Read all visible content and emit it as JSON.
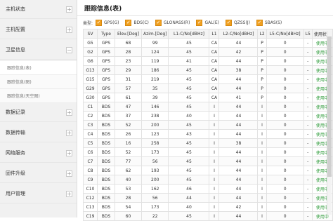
{
  "sidebar": {
    "sections": [
      {
        "label": "主机状态"
      },
      {
        "label": "主机配置"
      },
      {
        "label": "卫星信息",
        "sub": [
          {
            "label": "跟踪信息(表)"
          },
          {
            "label": "跟踪信息(图)"
          },
          {
            "label": "跟踪信息(天空图)"
          }
        ]
      },
      {
        "label": "数据记录"
      },
      {
        "label": "数据传输"
      },
      {
        "label": "网络服务"
      },
      {
        "label": "固件升级"
      },
      {
        "label": "用户管理"
      }
    ]
  },
  "page": {
    "title": "跟踪信息(表)"
  },
  "filters": {
    "label": "类型:",
    "items": [
      {
        "label": "GPS(G)",
        "checked": true
      },
      {
        "label": "BDS(C)",
        "checked": true
      },
      {
        "label": "GLONASS(R)",
        "checked": true
      },
      {
        "label": "GAL(E)",
        "checked": true
      },
      {
        "label": "QZSS(J)",
        "checked": true
      },
      {
        "label": "SBAS(S)",
        "checked": true
      }
    ]
  },
  "table": {
    "columns": [
      "SV",
      "Type",
      "Elev.[Deg]",
      "Azim.[Deg]",
      "L1-C/No[dBHz]",
      "L1",
      "L2-C/No[dBHz]",
      "L2",
      "L5-C/No[dBHz]",
      "L5",
      "使用状态"
    ],
    "rows": [
      [
        "G5",
        "GPS",
        "68",
        "99",
        "45",
        "CA",
        "44",
        "P",
        "0",
        "-",
        "使用中"
      ],
      [
        "G2",
        "GPS",
        "28",
        "124",
        "45",
        "CA",
        "42",
        "P",
        "0",
        "-",
        "使用中"
      ],
      [
        "G6",
        "GPS",
        "23",
        "119",
        "41",
        "CA",
        "44",
        "P",
        "0",
        "-",
        "使用中"
      ],
      [
        "G13",
        "GPS",
        "29",
        "186",
        "45",
        "CA",
        "38",
        "P",
        "0",
        "-",
        "使用中"
      ],
      [
        "G15",
        "GPS",
        "31",
        "219",
        "45",
        "CA",
        "44",
        "P",
        "0",
        "-",
        "使用中"
      ],
      [
        "G29",
        "GPS",
        "57",
        "35",
        "45",
        "CA",
        "44",
        "P",
        "0",
        "-",
        "使用中"
      ],
      [
        "G30",
        "GPS",
        "61",
        "39",
        "45",
        "CA",
        "41",
        "P",
        "0",
        "-",
        "使用中"
      ],
      [
        "C1",
        "BDS",
        "47",
        "146",
        "45",
        "I",
        "44",
        "I",
        "0",
        "-",
        "使用中"
      ],
      [
        "C2",
        "BDS",
        "37",
        "238",
        "40",
        "I",
        "44",
        "I",
        "0",
        "-",
        "使用中"
      ],
      [
        "C3",
        "BDS",
        "52",
        "200",
        "45",
        "I",
        "44",
        "I",
        "0",
        "-",
        "使用中"
      ],
      [
        "C4",
        "BDS",
        "26",
        "123",
        "43",
        "I",
        "44",
        "I",
        "0",
        "-",
        "使用中"
      ],
      [
        "C5",
        "BDS",
        "16",
        "258",
        "45",
        "I",
        "38",
        "I",
        "0",
        "-",
        "使用中"
      ],
      [
        "C6",
        "BDS",
        "52",
        "173",
        "45",
        "I",
        "44",
        "I",
        "0",
        "-",
        "使用中"
      ],
      [
        "C7",
        "BDS",
        "77",
        "56",
        "45",
        "I",
        "44",
        "I",
        "0",
        "-",
        "使用中"
      ],
      [
        "C8",
        "BDS",
        "62",
        "193",
        "45",
        "I",
        "44",
        "I",
        "0",
        "-",
        "使用中"
      ],
      [
        "C9",
        "BDS",
        "40",
        "200",
        "45",
        "I",
        "44",
        "I",
        "0",
        "-",
        "使用中"
      ],
      [
        "C10",
        "BDS",
        "53",
        "162",
        "46",
        "I",
        "44",
        "I",
        "0",
        "-",
        "使用中"
      ],
      [
        "C12",
        "BDS",
        "28",
        "56",
        "44",
        "I",
        "44",
        "I",
        "0",
        "-",
        "使用中"
      ],
      [
        "C13",
        "BDS",
        "54",
        "173",
        "40",
        "I",
        "42",
        "I",
        "0",
        "-",
        "使用中"
      ],
      [
        "C19",
        "BDS",
        "60",
        "22",
        "45",
        "I",
        "44",
        "I",
        "0",
        "-",
        "使用中"
      ]
    ]
  }
}
